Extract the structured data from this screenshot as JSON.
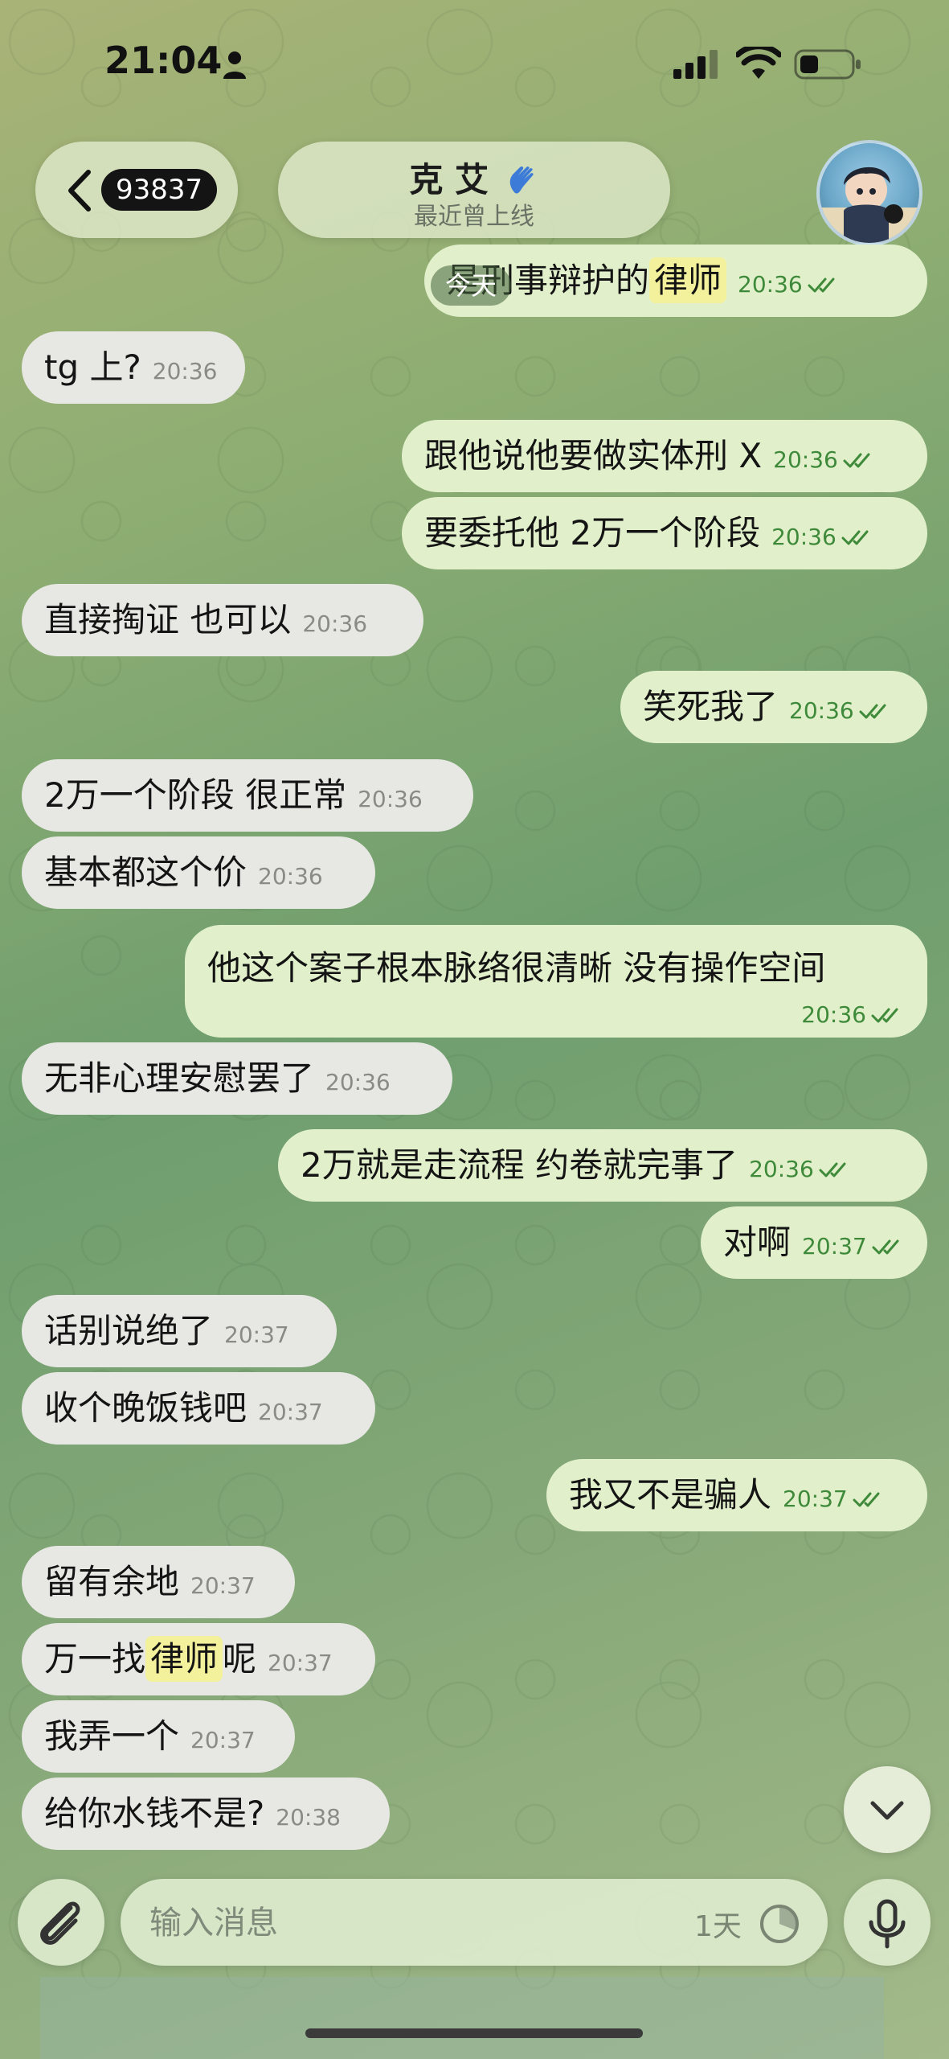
{
  "status_bar": {
    "time": "21:04"
  },
  "header": {
    "back_badge": "93837",
    "chat_name": "克 艾",
    "chat_status": "最近曾上线",
    "date_chip": "今天"
  },
  "messages": [
    {
      "dir": "out",
      "text_before": "是刑事辩护的",
      "highlight": "律师",
      "time": "20:36"
    },
    {
      "dir": "in",
      "text": "tg 上?",
      "time": "20:36"
    },
    {
      "dir": "out",
      "text": "跟他说他要做实体刑 X",
      "time": "20:36"
    },
    {
      "dir": "out",
      "text": "要委托他 2万一个阶段",
      "time": "20:36"
    },
    {
      "dir": "in",
      "text": "直接掏证 也可以",
      "time": "20:36"
    },
    {
      "dir": "out",
      "text": "笑死我了",
      "time": "20:36"
    },
    {
      "dir": "in",
      "text": "2万一个阶段 很正常",
      "time": "20:36"
    },
    {
      "dir": "in",
      "text": "基本都这个价",
      "time": "20:36"
    },
    {
      "dir": "out",
      "text": "他这个案子根本脉络很清晰 没有操作空间",
      "time": "20:36"
    },
    {
      "dir": "in",
      "text": "无非心理安慰罢了",
      "time": "20:36"
    },
    {
      "dir": "out",
      "text": "2万就是走流程 约卷就完事了",
      "time": "20:36"
    },
    {
      "dir": "out",
      "text": "对啊",
      "time": "20:37"
    },
    {
      "dir": "in",
      "text": "话别说绝了",
      "time": "20:37"
    },
    {
      "dir": "in",
      "text": "收个晚饭钱吧",
      "time": "20:37"
    },
    {
      "dir": "out",
      "text": "我又不是骗人",
      "time": "20:37"
    },
    {
      "dir": "in",
      "text": "留有余地",
      "time": "20:37"
    },
    {
      "dir": "in",
      "text_before": "万一找",
      "highlight": "律师",
      "text_after": "呢",
      "time": "20:37"
    },
    {
      "dir": "in",
      "text": "我弄一个",
      "time": "20:37"
    },
    {
      "dir": "in",
      "text": "给你水钱不是?",
      "time": "20:38"
    }
  ],
  "composer": {
    "placeholder": "输入消息",
    "timer_label": "1天"
  },
  "colors": {
    "incoming_bubble": "#e7e7e3",
    "outgoing_bubble": "#e1f0cb",
    "outgoing_time": "#3f8a3a",
    "highlight": "#f3f19c"
  },
  "icons": [
    "person-icon",
    "signal-icon",
    "wifi-icon",
    "battery-icon",
    "back-chevron-icon",
    "wave-emoji-icon",
    "read-ticks-icon",
    "chevron-down-icon",
    "paperclip-icon",
    "timer-icon",
    "microphone-icon"
  ]
}
